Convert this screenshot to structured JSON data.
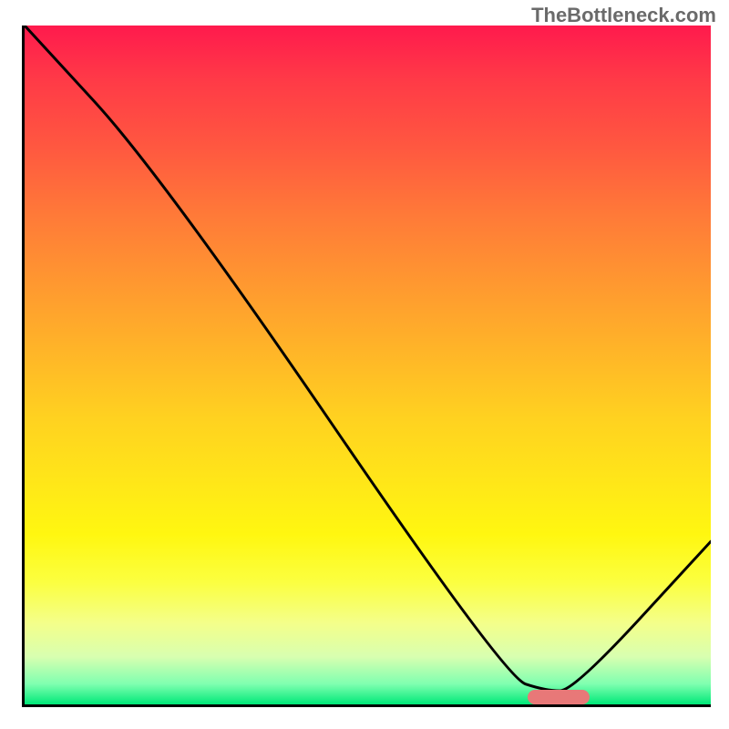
{
  "watermark": "TheBottleneck.com",
  "chart_data": {
    "type": "line",
    "title": "",
    "xlabel": "",
    "ylabel": "",
    "xlim": [
      0,
      100
    ],
    "ylim": [
      0,
      100
    ],
    "series": [
      {
        "name": "curve",
        "x": [
          0,
          20,
          70,
          76,
          80,
          100
        ],
        "values": [
          100,
          78,
          4,
          2,
          2,
          24
        ]
      }
    ],
    "annotations": [
      {
        "name": "marker",
        "x_start": 73,
        "x_end": 82,
        "y": 1.5,
        "color": "#e87878"
      }
    ],
    "background": "vertical-gradient red-orange-yellow-green",
    "grid": false,
    "legend": false
  }
}
